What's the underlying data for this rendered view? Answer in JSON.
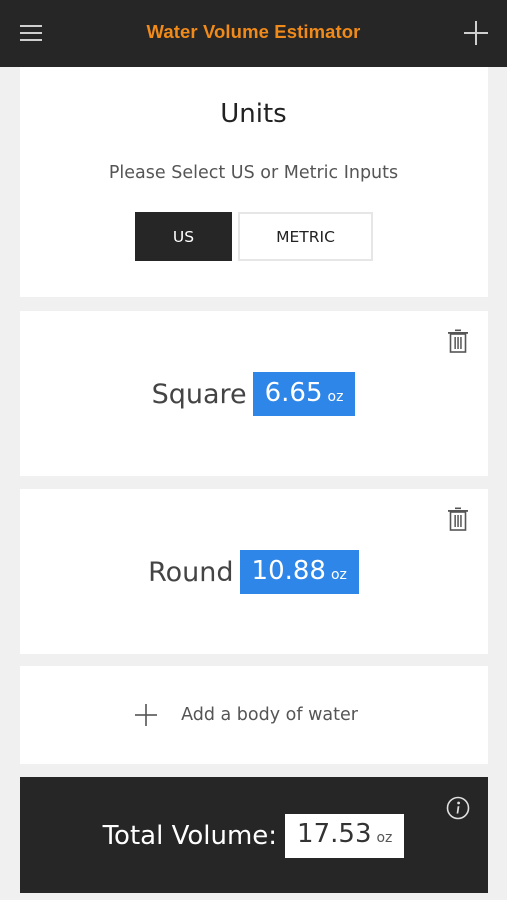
{
  "header": {
    "title": "Water Volume Estimator",
    "menu_icon": "hamburger-icon",
    "add_icon": "plus-icon",
    "title_color": "#f08a1a",
    "background": "#262626"
  },
  "units": {
    "title": "Units",
    "subtitle": "Please Select US or Metric Inputs",
    "options": [
      {
        "label": "US",
        "selected": true
      },
      {
        "label": "METRIC",
        "selected": false
      }
    ]
  },
  "bodies": [
    {
      "name": "Square",
      "value": "6.65",
      "unit": "oz",
      "delete_icon": "trash-icon"
    },
    {
      "name": "Round",
      "value": "10.88",
      "unit": "oz",
      "delete_icon": "trash-icon"
    }
  ],
  "add_body": {
    "label": "Add a body of water",
    "icon": "plus-icon"
  },
  "total": {
    "label": "Total Volume:",
    "value": "17.53",
    "unit": "oz",
    "info_icon": "info-icon"
  },
  "colors": {
    "accent": "#2f86e9",
    "dark": "#262626"
  }
}
